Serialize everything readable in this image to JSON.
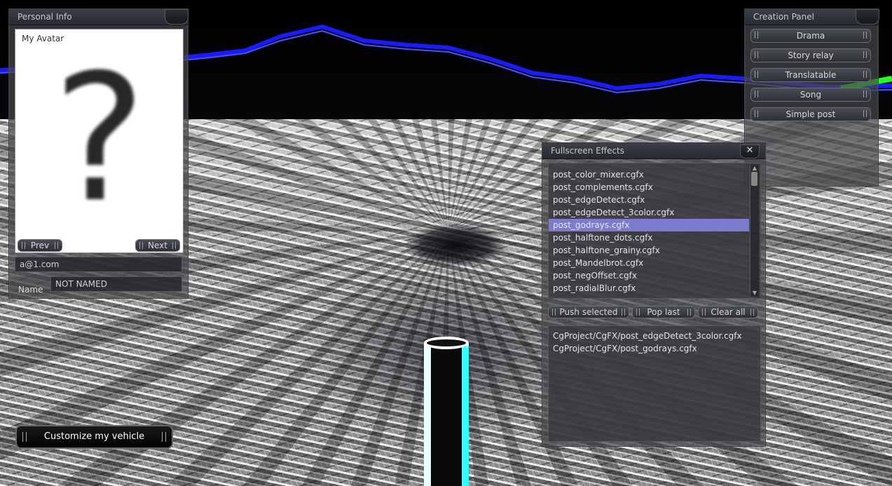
{
  "personal_info": {
    "title": "Personal Info",
    "avatar_label": "My Avatar",
    "avatar_glyph": "?",
    "prev_label": "Prev",
    "next_label": "Next",
    "email": "a@1.com",
    "name_label": "Name",
    "name_value": "NOT NAMED"
  },
  "customize_label": "Customize my vehicle",
  "creation_panel": {
    "title": "Creation Panel",
    "buttons": [
      "Drama",
      "Story relay",
      "Translatable",
      "Song",
      "Simple post"
    ]
  },
  "fullscreen_effects": {
    "title": "Fullscreen Effects",
    "close_glyph": "✕",
    "effects": [
      "post_color_mixer.cgfx",
      "post_complements.cgfx",
      "post_edgeDetect.cgfx",
      "post_edgeDetect_3color.cgfx",
      "post_godrays.cgfx",
      "post_halftone_dots.cgfx",
      "post_halftone_grainy.cgfx",
      "post_Mandelbrot.cgfx",
      "post_negOffset.cgfx",
      "post_radialBlur.cgfx"
    ],
    "selected_index": 4,
    "push_label": "Push selected",
    "pop_label": "Pop last",
    "clear_label": "Clear all",
    "stack": [
      "CgProject/CgFX/post_edgeDetect_3color.cgfx",
      "CgProject/CgFX/post_godrays.cgfx"
    ]
  }
}
